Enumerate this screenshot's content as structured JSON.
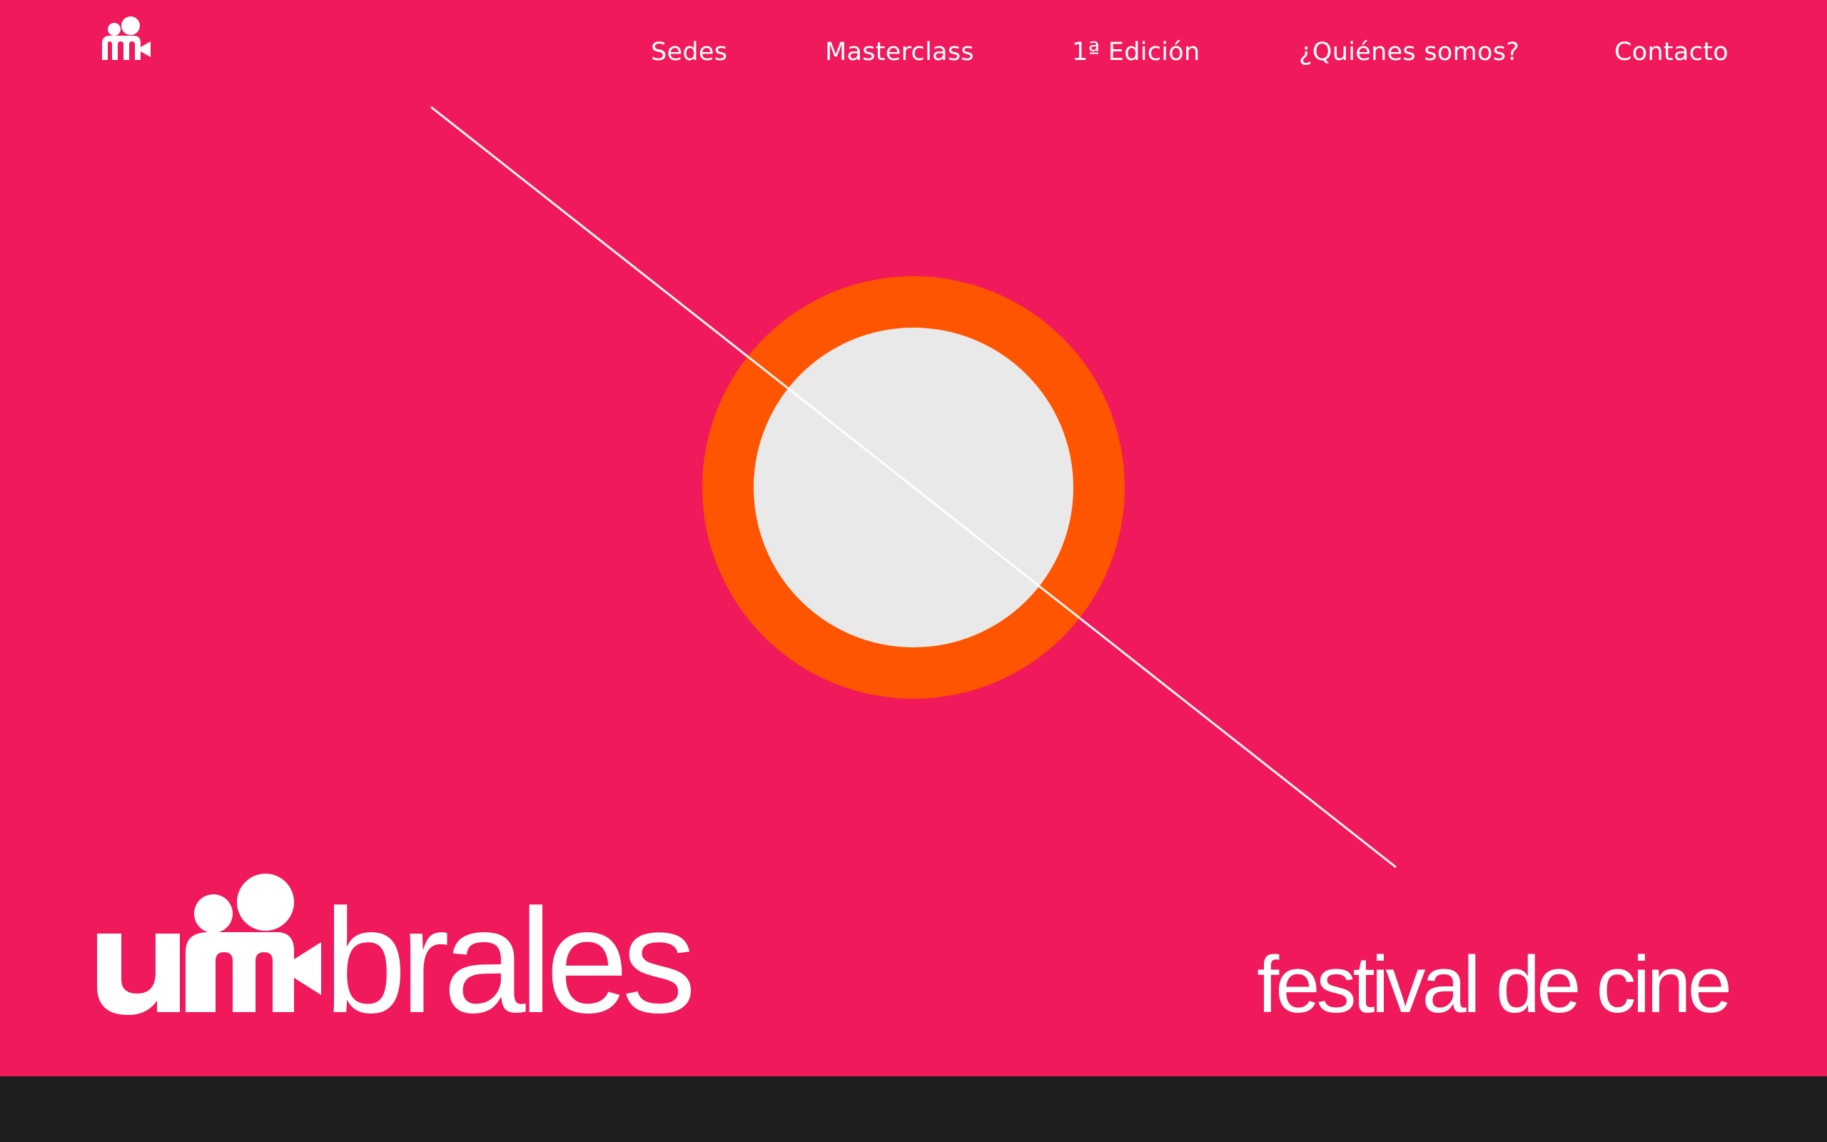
{
  "site": {
    "logo_icon": "umbrales-camera-people-icon",
    "brand_name": "umbrales",
    "tagline": "festival de cine"
  },
  "nav": {
    "items": [
      {
        "label": "Sedes"
      },
      {
        "label": "Masterclass"
      },
      {
        "label": "1ª Edición"
      },
      {
        "label": "¿Quiénes somos?"
      },
      {
        "label": "Contacto"
      }
    ]
  },
  "colors": {
    "hero_background": "#ef195b",
    "ring": "#ff5400",
    "disc": "#e9e9e9",
    "line": "#ffffff",
    "footer_band": "#1e1e1e",
    "text": "#ffffff"
  }
}
